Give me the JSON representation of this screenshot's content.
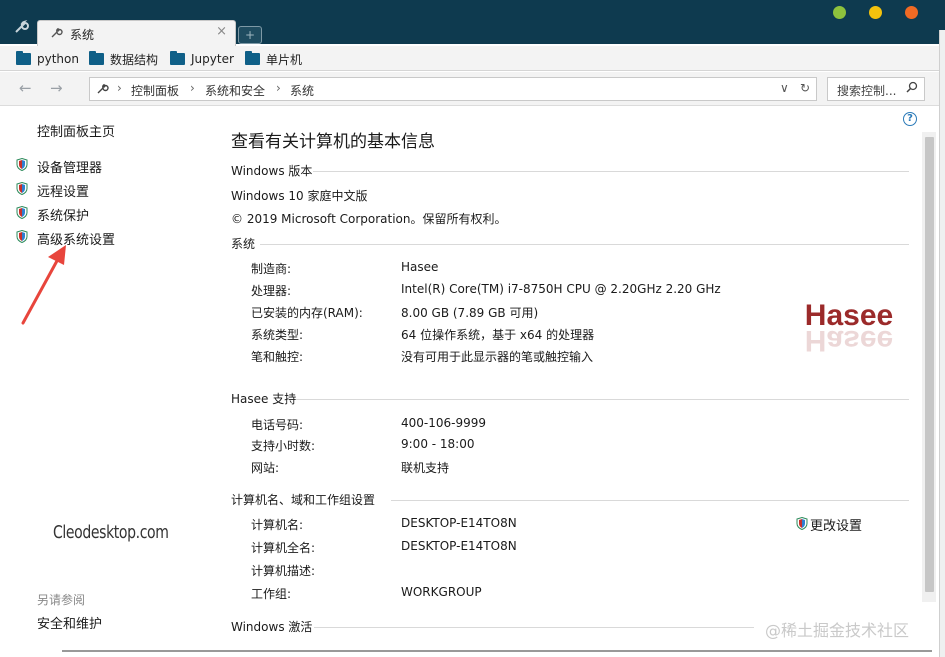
{
  "browser": {
    "tab_title": "系统",
    "tab_close": "×",
    "new_tab": "+",
    "window_dots": [
      "#8ec23d",
      "#f4c20d",
      "#f06a24"
    ]
  },
  "bookmarks": [
    "python",
    "数据结构",
    "Jupyter",
    "单片机"
  ],
  "address_bar": {
    "back": "←",
    "forward": "→",
    "crumbs": [
      "控制面板",
      "系统和安全",
      "系统"
    ],
    "dropdown": "∨",
    "refresh": "↻",
    "search_placeholder": "搜索控制...",
    "search_icon": "⚲"
  },
  "sidebar": {
    "home": "控制面板主页",
    "items": [
      "设备管理器",
      "远程设置",
      "系统保护",
      "高级系统设置"
    ],
    "see_also_title": "另请参阅",
    "see_also_items": [
      "安全和维护"
    ]
  },
  "watermarks": {
    "left": "Cleodesktop.com",
    "right": "@稀土掘金技术社区"
  },
  "main": {
    "title": "查看有关计算机的基本信息",
    "help": "?",
    "windows_edition": {
      "heading": "Windows 版本",
      "edition": "Windows 10 家庭中文版",
      "copyright": "© 2019 Microsoft Corporation。保留所有权利。"
    },
    "system": {
      "heading": "系统",
      "rows": [
        {
          "label": "制造商:",
          "value": "Hasee"
        },
        {
          "label": "处理器:",
          "value": "Intel(R) Core(TM) i7-8750H CPU @ 2.20GHz   2.20 GHz"
        },
        {
          "label": "已安装的内存(RAM):",
          "value": "8.00 GB (7.89 GB 可用)"
        },
        {
          "label": "系统类型:",
          "value": "64 位操作系统，基于 x64 的处理器"
        },
        {
          "label": "笔和触控:",
          "value": "没有可用于此显示器的笔或触控输入"
        }
      ],
      "logo_text": "Hasee"
    },
    "support": {
      "heading": "Hasee 支持",
      "rows": [
        {
          "label": "电话号码:",
          "value": "400-106-9999"
        },
        {
          "label": "支持小时数:",
          "value": "9:00 - 18:00"
        },
        {
          "label": "网站:",
          "value": "联机支持"
        }
      ]
    },
    "computer": {
      "heading": "计算机名、域和工作组设置",
      "change": "更改设置",
      "rows": [
        {
          "label": "计算机名:",
          "value": "DESKTOP-E14TO8N"
        },
        {
          "label": "计算机全名:",
          "value": "DESKTOP-E14TO8N"
        },
        {
          "label": "计算机描述:",
          "value": ""
        },
        {
          "label": "工作组:",
          "value": "WORKGROUP"
        }
      ]
    },
    "activation": {
      "heading": "Windows 激活"
    }
  },
  "colors": {
    "titlebar": "#0e3a4f",
    "folder": "#0f5f87",
    "arrow": "#e8453c",
    "logo": "#9b2a2a"
  }
}
